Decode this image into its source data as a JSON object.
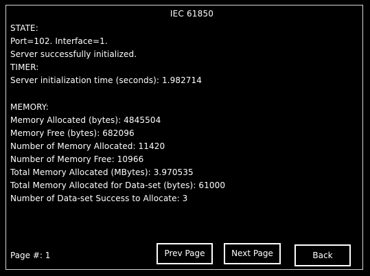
{
  "title": "IEC 61850",
  "lines": [
    "STATE:",
    "Port=102. Interface=1.",
    "Server successfully initialized.",
    "TIMER:",
    "Server initialization time (seconds): 1.982714",
    "",
    "MEMORY:",
    "Memory Allocated (bytes): 4845504",
    "Memory Free (bytes): 682096",
    "Number of Memory Allocated: 11420",
    "Number of Memory Free: 10966",
    "Total Memory Allocated (MBytes): 3.970535",
    "Total Memory Allocated for Data-set (bytes): 61000",
    "Number of Data-set Success to Allocate: 3"
  ],
  "footer": {
    "page_label": "Page #: 1",
    "prev_label": "Prev Page",
    "next_label": "Next Page",
    "back_label": "Back"
  }
}
